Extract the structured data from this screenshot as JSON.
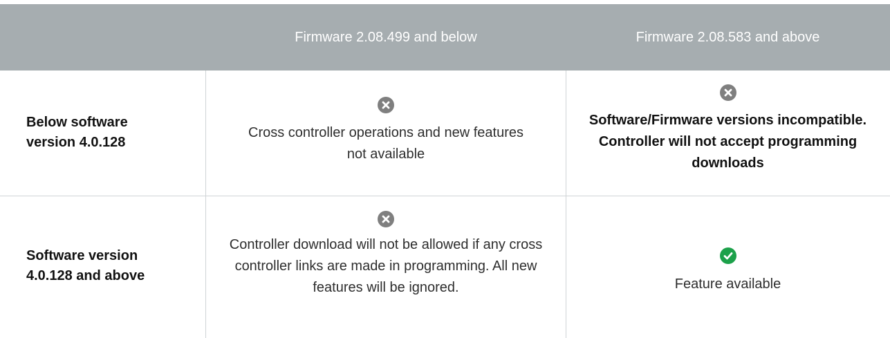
{
  "header": {
    "col1": "",
    "col2": "Firmware 2.08.499 and below",
    "col3": "Firmware 2.08.583 and above"
  },
  "rows": [
    {
      "label": "Below software version 4.0.128",
      "cell2": {
        "icon": "x-circle-icon",
        "text": "Cross controller operations and new features not available"
      },
      "cell3": {
        "icon": "x-circle-icon",
        "text": "Software/Firmware versions incompatible. Controller will not accept programming downloads"
      }
    },
    {
      "label": "Software version 4.0.128 and above",
      "cell2": {
        "icon": "x-circle-icon",
        "text": "Controller download will not be allowed if any cross controller links are made in programming. All new features will be ignored."
      },
      "cell3": {
        "icon": "check-circle-icon",
        "text": "Feature available"
      }
    }
  ],
  "colors": {
    "header_bg": "#a6adb0",
    "x_icon": "#7f7f7f",
    "check_icon": "#1ca14a",
    "grid_line": "#cfd3d5"
  }
}
